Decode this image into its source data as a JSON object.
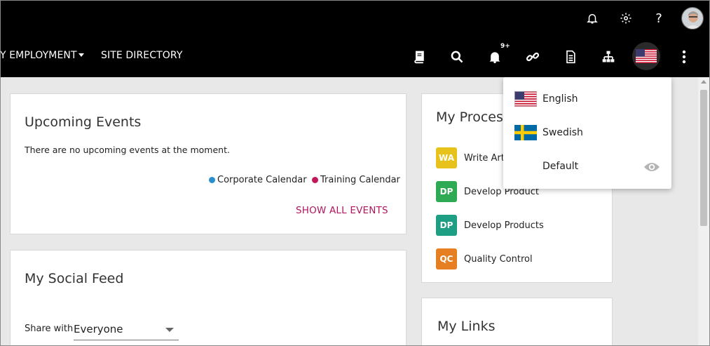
{
  "navbar": {
    "employment_label": "Y EMPLOYMENT",
    "site_directory_label": "SITE DIRECTORY",
    "notification_badge": "9+",
    "help_label": "?"
  },
  "upcoming_events": {
    "title": "Upcoming Events",
    "empty_message": "There are no upcoming events at the moment.",
    "legend": [
      {
        "label": "Corporate Calendar",
        "color": "#2a8fd0"
      },
      {
        "label": "Training Calendar",
        "color": "#c2185b"
      }
    ],
    "show_all_label": "SHOW ALL EVENTS"
  },
  "my_processes": {
    "title": "My Proces",
    "items": [
      {
        "initials": "WA",
        "label": "Write Arti",
        "color": "#e6c21a"
      },
      {
        "initials": "DP",
        "label": "Develop Product",
        "color": "#2eaa55"
      },
      {
        "initials": "DP",
        "label": "Develop Products",
        "color": "#1e9e82"
      },
      {
        "initials": "QC",
        "label": "Quality Control",
        "color": "#e67e22"
      }
    ]
  },
  "social_feed": {
    "title": "My Social Feed",
    "share_with_label": "Share with",
    "share_with_value": "Everyone"
  },
  "my_links": {
    "title": "My Links"
  },
  "language_menu": {
    "items": [
      {
        "label": "English",
        "flag": "us-flag"
      },
      {
        "label": "Swedish",
        "flag": "swedish-flag"
      },
      {
        "label": "Default",
        "flag": "none"
      }
    ]
  },
  "colors": {
    "accent": "#b0155e",
    "topbar": "#000000"
  }
}
